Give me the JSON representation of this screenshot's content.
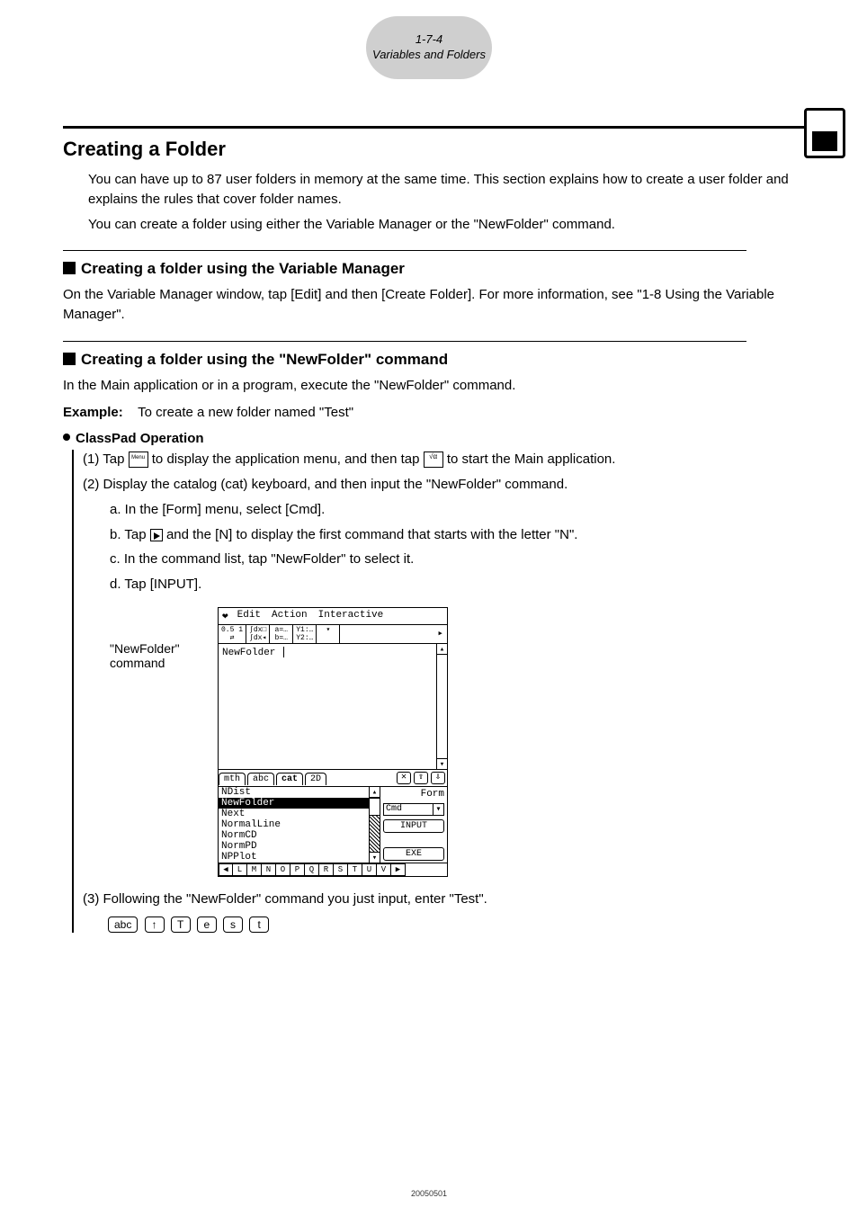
{
  "header": {
    "page_ref": "1-7-4",
    "section_ref": "Variables and Folders"
  },
  "h2": "Creating a Folder",
  "intro1": "You can have up to 87 user folders in memory at the same time. This section explains how to create a user folder and explains the rules that cover folder names.",
  "intro2": "You can create a folder using either the Variable Manager or the \"NewFolder\" command.",
  "sub1": "Creating a folder using the Variable Manager",
  "sub1_p": "On the Variable Manager window, tap [Edit] and then [Create Folder]. For more information, see \"1-8 Using the Variable Manager\".",
  "sub2": "Creating a folder using the \"NewFolder\" command",
  "sub2_p": "In the Main application or in a program, execute the \"NewFolder\" command.",
  "example_label": "Example:",
  "example_text": "To create a new folder named \"Test\"",
  "op_head": "ClassPad Operation",
  "step1a": "(1) Tap ",
  "step1b": " to display the application menu, and then tap ",
  "step1c": " to start the Main application.",
  "step2": "(2) Display the catalog (cat) keyboard, and then input the \"NewFolder\" command.",
  "step2a": "a. In the [Form] menu, select [Cmd].",
  "step2b_a": "b. Tap ",
  "step2b_b": " and the [N] to display the first command that starts with the letter \"N\".",
  "step2c": "c. In the command list, tap \"NewFolder\" to select it.",
  "step2d": "d. Tap [INPUT].",
  "shot_label1": "\"NewFolder\"",
  "shot_label2": "command",
  "scr": {
    "menu": {
      "icon": "❤",
      "edit": "Edit",
      "action": "Action",
      "interactive": "Interactive"
    },
    "body_text": "NewFolder ",
    "tabs": {
      "mth": "mth",
      "abc": "abc",
      "cat": "cat",
      "twoD": "2D"
    },
    "tab_btn_x": "✕",
    "tab_btn_up": "⇧",
    "tab_btn_dn": "⇩",
    "list": [
      "NDist",
      "NewFolder",
      "Next",
      "NormalLine",
      "NormCD",
      "NormPD",
      "NPPlot"
    ],
    "form_label": "Form",
    "form_value": "Cmd",
    "btn_input": "INPUT",
    "btn_exe": "EXE",
    "alpha": [
      "◀",
      "L",
      "M",
      "N",
      "O",
      "P",
      "Q",
      "R",
      "S",
      "T",
      "U",
      "V",
      "▶"
    ]
  },
  "step3": "(3) Following the \"NewFolder\" command you just input, enter \"Test\".",
  "keys": [
    "abc",
    "↑",
    "T",
    "e",
    "s",
    "t"
  ],
  "footer_num": "20050501"
}
